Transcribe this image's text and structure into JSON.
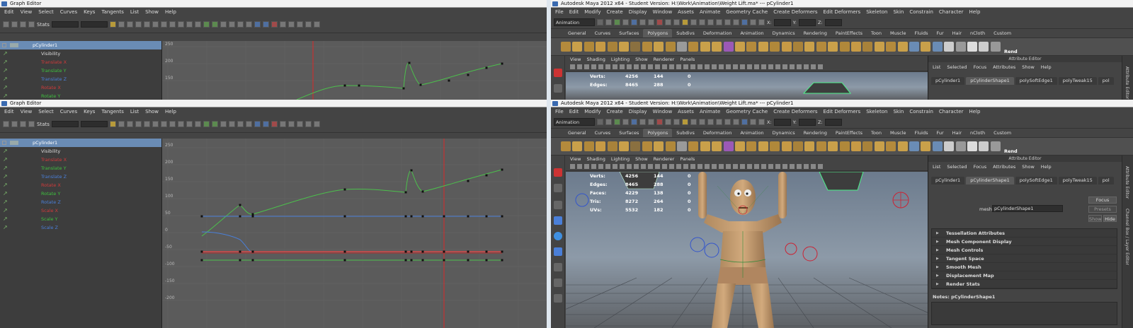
{
  "graph_editor_top": {
    "title": "Graph Editor",
    "menu": [
      "Edit",
      "View",
      "Select",
      "Curves",
      "Keys",
      "Tangents",
      "List",
      "Show",
      "Help"
    ],
    "stats_label": "Stats",
    "outliner": {
      "object": "pCylinder1",
      "attrs": [
        {
          "label": "Visibility",
          "color": "#dddddd"
        },
        {
          "label": "Translate X",
          "color": "#d03a3a"
        },
        {
          "label": "Translate Y",
          "color": "#3ec03e"
        },
        {
          "label": "Translate Z",
          "color": "#4a7fd8"
        },
        {
          "label": "Rotate X",
          "color": "#d03a3a"
        },
        {
          "label": "Rotate Y",
          "color": "#3ec03e"
        }
      ]
    },
    "y_ticks": [
      "250",
      "200",
      "150"
    ]
  },
  "graph_editor_bottom": {
    "title": "Graph Editor",
    "menu": [
      "Edit",
      "View",
      "Select",
      "Curves",
      "Keys",
      "Tangents",
      "List",
      "Show",
      "Help"
    ],
    "stats_label": "Stats",
    "outliner": {
      "object": "pCylinder1",
      "attrs": [
        {
          "label": "Visibility",
          "color": "#dddddd"
        },
        {
          "label": "Translate X",
          "color": "#d03a3a"
        },
        {
          "label": "Translate Y",
          "color": "#3ec03e"
        },
        {
          "label": "Translate Z",
          "color": "#4a7fd8"
        },
        {
          "label": "Rotate X",
          "color": "#d03a3a"
        },
        {
          "label": "Rotate Y",
          "color": "#3ec03e"
        },
        {
          "label": "Rotate Z",
          "color": "#4a7fd8"
        },
        {
          "label": "Scale X",
          "color": "#d03a3a"
        },
        {
          "label": "Scale Y",
          "color": "#3ec03e"
        },
        {
          "label": "Scale Z",
          "color": "#4a7fd8"
        }
      ]
    },
    "y_ticks": [
      "250",
      "200",
      "150",
      "100",
      "50",
      "0",
      "-50",
      "-100",
      "-150",
      "-200"
    ]
  },
  "maya_top": {
    "title": "Autodesk Maya 2012 x64 - Student Version: H:\\Work\\Animation\\Weight Lift.ma*  ---  pCylinder1",
    "menu": [
      "File",
      "Edit",
      "Modify",
      "Create",
      "Display",
      "Window",
      "Assets",
      "Animate",
      "Geometry Cache",
      "Create Deformers",
      "Edit Deformers",
      "Skeleton",
      "Skin",
      "Constrain",
      "Character",
      "Help"
    ],
    "mode": "Animation",
    "x_label": "X:",
    "y_label": "Y:",
    "z_label": "Z:",
    "shelf_tabs": [
      "General",
      "Curves",
      "Surfaces",
      "Polygons",
      "Subdivs",
      "Deformation",
      "Animation",
      "Dynamics",
      "Rendering",
      "PaintEffects",
      "Toon",
      "Muscle",
      "Fluids",
      "Fur",
      "Hair",
      "nCloth",
      "Custom"
    ],
    "active_shelf": "Polygons",
    "render_label": "Rend",
    "viewport_menu": [
      "View",
      "Shading",
      "Lighting",
      "Show",
      "Renderer",
      "Panels"
    ],
    "hud": [
      {
        "k": "Verts:",
        "v": "4256",
        "v2": "144",
        "v3": "0"
      },
      {
        "k": "Edges:",
        "v": "8465",
        "v2": "288",
        "v3": "0"
      }
    ],
    "attr_editor": {
      "title": "Attribute Editor",
      "menu": [
        "List",
        "Selected",
        "Focus",
        "Attributes",
        "Show",
        "Help"
      ],
      "tabs": [
        "pCylinder1",
        "pCylinderShape1",
        "polySoftEdge1",
        "polyTweak15",
        "pol"
      ],
      "active_tab": "pCylinderShape1",
      "side_label": "Attribute Editor"
    }
  },
  "maya_bottom": {
    "title": "Autodesk Maya 2012 x64 - Student Version: H:\\Work\\Animation\\Weight Lift.ma*  ---  pCylinder1",
    "menu": [
      "File",
      "Edit",
      "Modify",
      "Create",
      "Display",
      "Window",
      "Assets",
      "Animate",
      "Geometry Cache",
      "Create Deformers",
      "Edit Deformers",
      "Skeleton",
      "Skin",
      "Constrain",
      "Character",
      "Help"
    ],
    "mode": "Animation",
    "x_label": "X:",
    "y_label": "Y:",
    "z_label": "Z:",
    "shelf_tabs": [
      "General",
      "Curves",
      "Surfaces",
      "Polygons",
      "Subdivs",
      "Deformation",
      "Animation",
      "Dynamics",
      "Rendering",
      "PaintEffects",
      "Toon",
      "Muscle",
      "Fluids",
      "Fur",
      "Hair",
      "nCloth",
      "Custom"
    ],
    "active_shelf": "Polygons",
    "render_label": "Rend",
    "viewport_menu": [
      "View",
      "Shading",
      "Lighting",
      "Show",
      "Renderer",
      "Panels"
    ],
    "hud": [
      {
        "k": "Verts:",
        "v": "4256",
        "v2": "144",
        "v3": "0"
      },
      {
        "k": "Edges:",
        "v": "8465",
        "v2": "288",
        "v3": "0"
      },
      {
        "k": "Faces:",
        "v": "4229",
        "v2": "138",
        "v3": "0"
      },
      {
        "k": "Tris:",
        "v": "8272",
        "v2": "264",
        "v3": "0"
      },
      {
        "k": "UVs:",
        "v": "5532",
        "v2": "182",
        "v3": "0"
      }
    ],
    "attr_editor": {
      "title": "Attribute Editor",
      "menu": [
        "List",
        "Selected",
        "Focus",
        "Attributes",
        "Show",
        "Help"
      ],
      "tabs": [
        "pCylinder1",
        "pCylinderShape1",
        "polySoftEdge1",
        "polyTweak15",
        "pol"
      ],
      "active_tab": "pCylinderShape1",
      "focus_label": "Focus",
      "presets_label": "Presets",
      "show_label": "Show",
      "hide_label": "Hide",
      "mesh_label": "mesh:",
      "mesh_value": "pCylinderShape1",
      "sections": [
        "Tessellation Attributes",
        "Mesh Component Display",
        "Mesh Controls",
        "Tangent Space",
        "Smooth Mesh",
        "Displacement Map",
        "Render Stats"
      ],
      "notes": "Notes:  pCylinderShape1",
      "side_label": "Attribute Editor",
      "side_label2": "Channel Box / Layer Editor"
    }
  },
  "colors": {
    "selection": "#6a8cb5",
    "timeline": "#d82a2a",
    "curve_green": "#4cc04c",
    "curve_blue": "#4a7fd8",
    "curve_red": "#d84a4a"
  }
}
